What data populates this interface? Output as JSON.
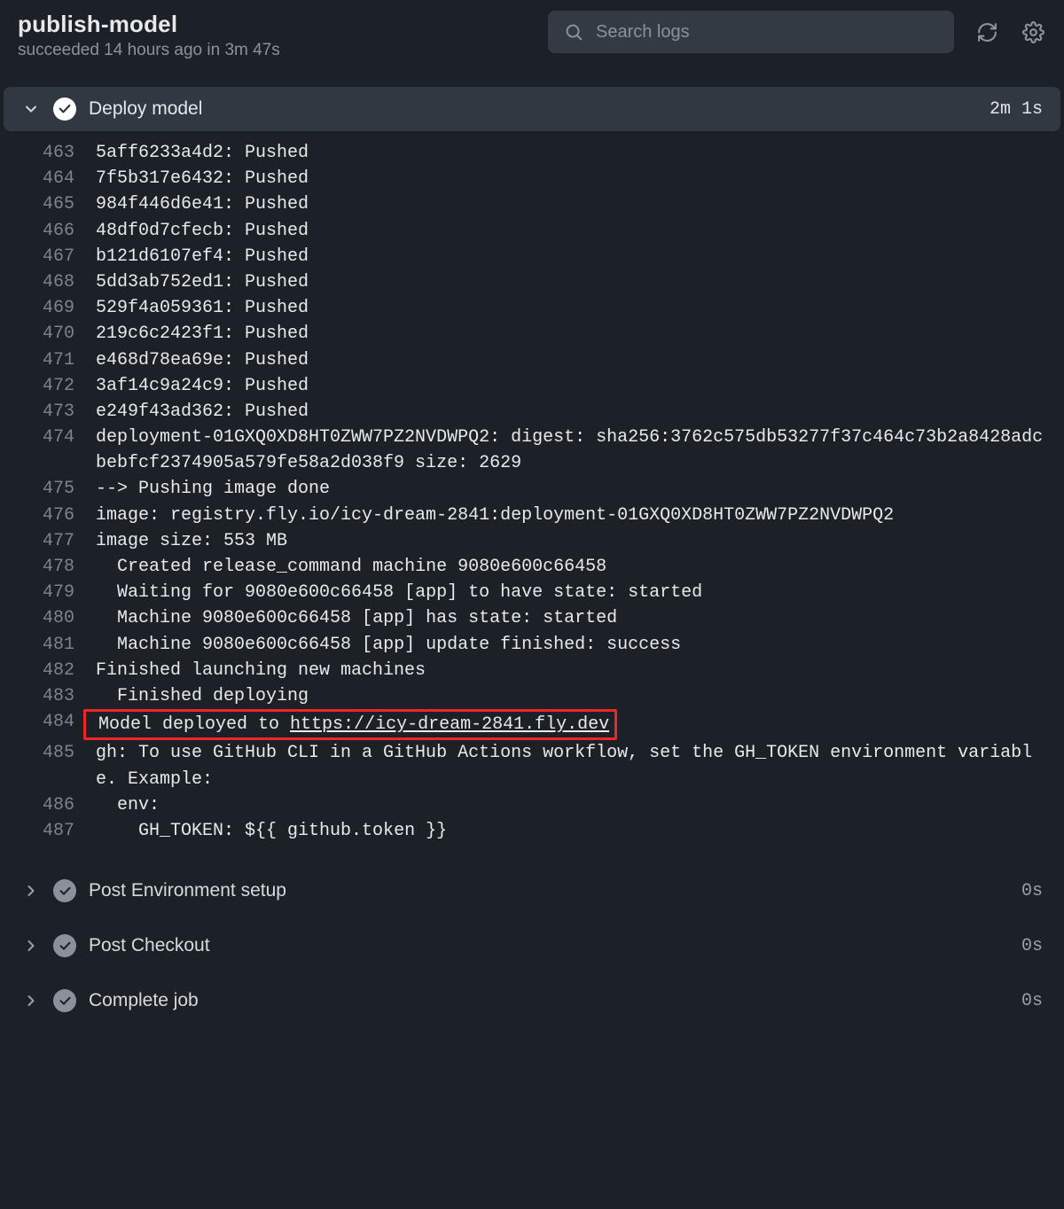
{
  "header": {
    "title": "publish-model",
    "subtitle": "succeeded 14 hours ago in 3m 47s",
    "search_placeholder": "Search logs"
  },
  "main_step": {
    "name": "Deploy model",
    "duration": "2m 1s",
    "log_lines": [
      {
        "n": "463",
        "t": "5aff6233a4d2: Pushed"
      },
      {
        "n": "464",
        "t": "7f5b317e6432: Pushed"
      },
      {
        "n": "465",
        "t": "984f446d6e41: Pushed"
      },
      {
        "n": "466",
        "t": "48df0d7cfecb: Pushed"
      },
      {
        "n": "467",
        "t": "b121d6107ef4: Pushed"
      },
      {
        "n": "468",
        "t": "5dd3ab752ed1: Pushed"
      },
      {
        "n": "469",
        "t": "529f4a059361: Pushed"
      },
      {
        "n": "470",
        "t": "219c6c2423f1: Pushed"
      },
      {
        "n": "471",
        "t": "e468d78ea69e: Pushed"
      },
      {
        "n": "472",
        "t": "3af14c9a24c9: Pushed"
      },
      {
        "n": "473",
        "t": "e249f43ad362: Pushed"
      },
      {
        "n": "474",
        "t": "deployment-01GXQ0XD8HT0ZWW7PZ2NVDWPQ2: digest: sha256:3762c575db53277f37c464c73b2a8428adcbebfcf2374905a579fe58a2d038f9 size: 2629"
      },
      {
        "n": "475",
        "t": "--> Pushing image done"
      },
      {
        "n": "476",
        "t": "image: registry.fly.io/icy-dream-2841:deployment-01GXQ0XD8HT0ZWW7PZ2NVDWPQ2"
      },
      {
        "n": "477",
        "t": "image size: 553 MB"
      },
      {
        "n": "478",
        "t": "  Created release_command machine 9080e600c66458"
      },
      {
        "n": "479",
        "t": "  Waiting for 9080e600c66458 [app] to have state: started"
      },
      {
        "n": "480",
        "t": "  Machine 9080e600c66458 [app] has state: started"
      },
      {
        "n": "481",
        "t": "  Machine 9080e600c66458 [app] update finished: success"
      },
      {
        "n": "482",
        "t": "Finished launching new machines"
      },
      {
        "n": "483",
        "t": "  Finished deploying"
      }
    ],
    "highlight": {
      "n": "484",
      "prefix": "Model deployed to ",
      "link_text": "https://icy-dream-2841.fly.dev"
    },
    "tail_lines": [
      {
        "n": "485",
        "t": "gh: To use GitHub CLI in a GitHub Actions workflow, set the GH_TOKEN environment variable. Example:"
      },
      {
        "n": "486",
        "t": "  env:"
      },
      {
        "n": "487",
        "t": "    GH_TOKEN: ${{ github.token }}"
      }
    ]
  },
  "post_steps": [
    {
      "name": "Post Environment setup",
      "duration": "0s"
    },
    {
      "name": "Post Checkout",
      "duration": "0s"
    },
    {
      "name": "Complete job",
      "duration": "0s"
    }
  ]
}
